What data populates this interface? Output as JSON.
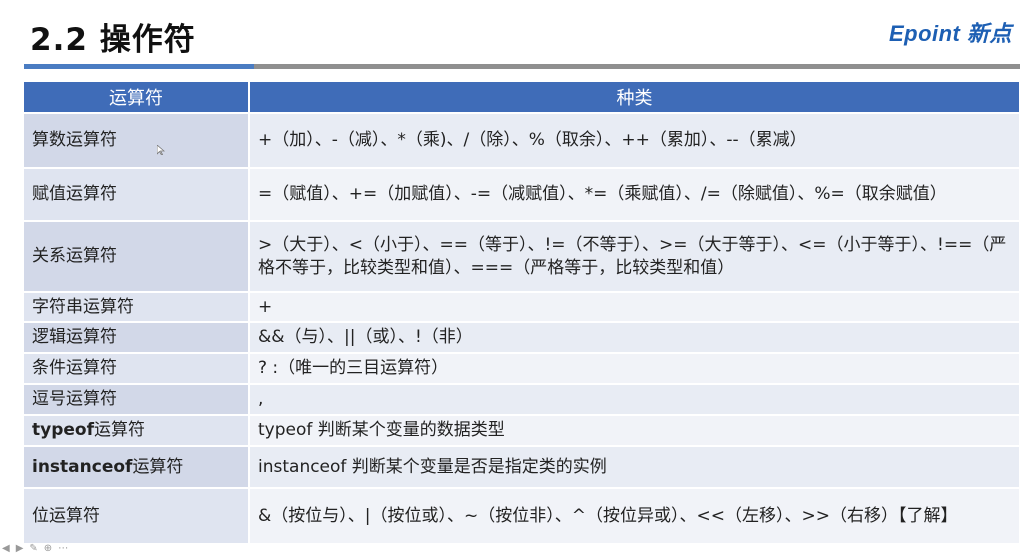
{
  "slide": {
    "title": "2.2 操作符",
    "logo": "Epoint 新点"
  },
  "table": {
    "headers": [
      "运算符",
      "种类"
    ],
    "rows": [
      {
        "name": "算数运算符",
        "desc": "+（加）、-（减）、*（乘)、/（除）、%（取余）、++（累加）、--（累减）"
      },
      {
        "name": "赋值运算符",
        "desc": "=（赋值）、+=（加赋值）、-=（减赋值）、*=（乘赋值）、/=（除赋值）、%=（取余赋值）"
      },
      {
        "name": "关系运算符",
        "desc": ">（大于）、<（小于）、==（等于）、!=（不等于）、>=（大于等于）、<=（小于等于）、!==（严格不等于，比较类型和值）、===（严格等于，比较类型和值）"
      },
      {
        "name": "字符串运算符",
        "desc": "+"
      },
      {
        "name": "逻辑运算符",
        "desc": "&&（与）、||（或）、!（非）"
      },
      {
        "name": "条件运算符",
        "desc": "? :（唯一的三目运算符）"
      },
      {
        "name": "逗号运算符",
        "desc": ","
      },
      {
        "name_bold": "typeof",
        "name_rest": "运算符",
        "desc": "typeof  判断某个变量的数据类型"
      },
      {
        "name_bold": "instanceof",
        "name_rest": "运算符",
        "desc": "instanceof 判断某个变量是否是指定类的实例"
      },
      {
        "name": "位运算符",
        "desc": "&（按位与）、|（按位或）、~（按位非）、^（按位异或）、<<（左移）、>>（右移）【了解】"
      }
    ]
  },
  "icons": {
    "cursor": "mouse-pointer-icon",
    "toolbar": [
      "prev-icon",
      "next-icon",
      "pen-icon",
      "zoom-icon",
      "menu-icon"
    ]
  }
}
